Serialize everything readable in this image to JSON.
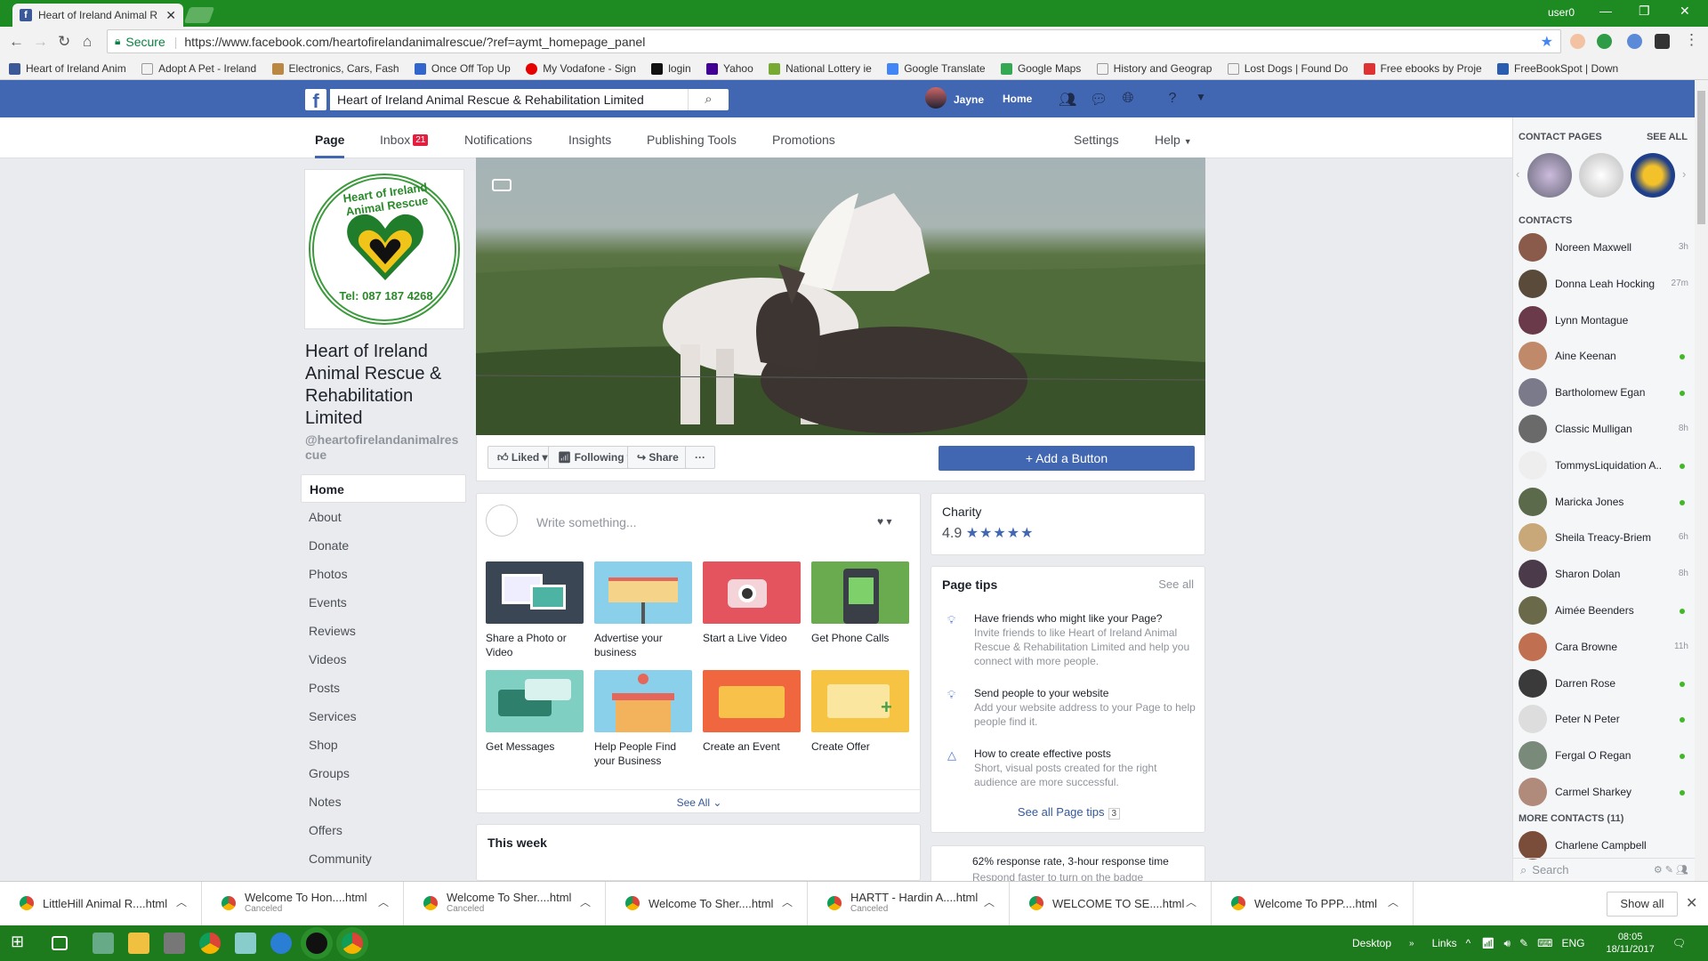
{
  "browser": {
    "tab_title": "Heart of Ireland Animal R",
    "window_user": "user0",
    "secure_label": "Secure",
    "url": "https://www.facebook.com/heartofirelandanimalrescue/?ref=aymt_homepage_panel",
    "bookmarks": [
      "Heart of Ireland Anim",
      "Adopt A Pet - Ireland",
      "Electronics, Cars, Fash",
      "Once Off Top Up",
      "My Vodafone - Sign",
      "login",
      "Yahoo",
      "National Lottery ie",
      "Google Translate",
      "Google Maps",
      "History and Geograp",
      "Lost Dogs | Found Do",
      "Free ebooks by Proje",
      "FreeBookSpot | Down"
    ]
  },
  "fb": {
    "search_value": "Heart of Ireland Animal Rescue & Rehabilitation Limited",
    "user_name": "Jayne",
    "home_label": "Home",
    "brand_color": "#4267b2"
  },
  "pagenav": {
    "items": [
      "Page",
      "Inbox",
      "Notifications",
      "Insights",
      "Publishing Tools",
      "Promotions"
    ],
    "inbox_count": "21",
    "settings": "Settings",
    "help": "Help"
  },
  "page": {
    "name": "Heart of Ireland Animal Rescue & Rehabilitation Limited",
    "handle": "@heartofirelandanimalrescue",
    "logo_text": "Heart of Ireland Animal Rescue",
    "logo_phone": "Tel: 087 187 4268"
  },
  "leftnav": [
    "Home",
    "About",
    "Donate",
    "Photos",
    "Events",
    "Reviews",
    "Videos",
    "Posts",
    "Services",
    "Shop",
    "Groups",
    "Notes",
    "Offers",
    "Community"
  ],
  "actions": {
    "liked": "Liked",
    "following": "Following",
    "share": "Share",
    "more": "···",
    "add_button": "+ Add a Button"
  },
  "composer": {
    "placeholder": "Write something...",
    "tiles": [
      "Share a Photo or Video",
      "Advertise your business",
      "Start a Live Video",
      "Get Phone Calls",
      "Get Messages",
      "Help People Find your Business",
      "Create an Event",
      "Create Offer"
    ],
    "see_all": "See All"
  },
  "this_week": "This week",
  "charity": {
    "category": "Charity",
    "rating": "4.9",
    "stars": "★★★★★"
  },
  "tips": {
    "title": "Page tips",
    "see_all": "See all",
    "items": [
      {
        "title": "Have friends who might like your Page?",
        "desc": "Invite friends to like Heart of Ireland Animal Rescue & Rehabilitation Limited and help you connect with more people."
      },
      {
        "title": "Send people to your website",
        "desc": "Add your website address to your Page to help people find it."
      },
      {
        "title": "How to create effective posts",
        "desc": "Short, visual posts created for the right audience are more successful."
      }
    ],
    "all_label": "See all Page tips",
    "all_count": "3"
  },
  "response": {
    "rate": "62% response rate, 3-hour response time",
    "desc": "Respond faster to turn on the badge"
  },
  "chat": {
    "contact_pages": "CONTACT PAGES",
    "see_all": "SEE ALL",
    "contacts_header": "CONTACTS",
    "contacts": [
      {
        "name": "Noreen Maxwell",
        "status": "3h"
      },
      {
        "name": "Donna Leah Hocking",
        "status": "27m"
      },
      {
        "name": "Lynn Montague",
        "status": ""
      },
      {
        "name": "Aine Keenan",
        "status": "online"
      },
      {
        "name": "Bartholomew Egan",
        "status": "online"
      },
      {
        "name": "Classic Mulligan",
        "status": "8h"
      },
      {
        "name": "TommysLiquidation A...",
        "status": "online"
      },
      {
        "name": "Maricka Jones",
        "status": "online"
      },
      {
        "name": "Sheila Treacy-Briem",
        "status": "6h"
      },
      {
        "name": "Sharon Dolan",
        "status": "8h"
      },
      {
        "name": "Aimée Beenders",
        "status": "online"
      },
      {
        "name": "Cara Browne",
        "status": "11h"
      },
      {
        "name": "Darren Rose",
        "status": "online"
      },
      {
        "name": "Peter N Peter",
        "status": "online"
      },
      {
        "name": "Fergal O Regan",
        "status": "online"
      },
      {
        "name": "Carmel Sharkey",
        "status": "online"
      }
    ],
    "more_contacts": "MORE CONTACTS (11)",
    "more_first": "Charlene Campbell",
    "search_placeholder": "Search"
  },
  "downloads": {
    "items": [
      {
        "name": "LittleHill Animal R....html",
        "status": ""
      },
      {
        "name": "Welcome To Hon....html",
        "status": "Canceled"
      },
      {
        "name": "Welcome To Sher....html",
        "status": "Canceled"
      },
      {
        "name": "Welcome To Sher....html",
        "status": ""
      },
      {
        "name": "HARTT - Hardin A....html",
        "status": "Canceled"
      },
      {
        "name": "WELCOME TO SE....html",
        "status": ""
      },
      {
        "name": "Welcome To PPP....html",
        "status": ""
      }
    ],
    "show_all": "Show all"
  },
  "taskbar": {
    "desktop": "Desktop",
    "links": "Links",
    "lang": "ENG",
    "time": "08:05",
    "date": "18/11/2017"
  }
}
